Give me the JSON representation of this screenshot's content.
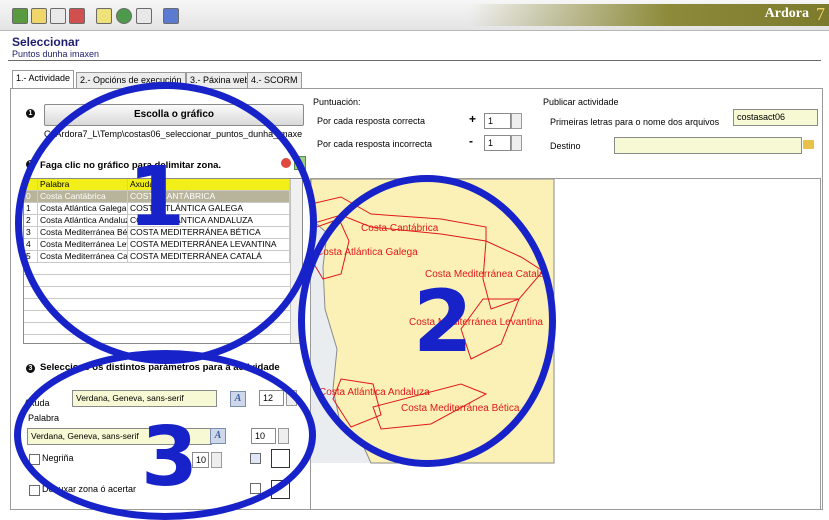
{
  "app": {
    "brand": "Ardora",
    "brand_version": "7",
    "title": "Seleccionar",
    "subtitle": "Puntos dunha imaxen"
  },
  "toolbar": {
    "buttons": [
      "new-doc-icon",
      "open-doc-icon",
      "save-doc-icon",
      "export-doc-icon",
      "page-icon",
      "web-globe-icon",
      "preview-icon",
      "help-icon"
    ]
  },
  "tabs": [
    {
      "label": "1.- Actividade",
      "active": true
    },
    {
      "label": "2.- Opcións de execución",
      "active": false
    },
    {
      "label": "3.- Páxina web",
      "active": false
    },
    {
      "label": "4.- SCORM",
      "active": false
    }
  ],
  "left": {
    "step1_bullet": "1",
    "choose_button": "Escolla o gráfico",
    "path": "C:\\Ardora7_L\\Temp\\costas06_seleccionar_puntos_dunha_imaxe\\",
    "step2_bullet": "2",
    "zone_label": "Faga clic no gráfico para delimitar zona.",
    "table": {
      "headers": [
        "",
        "Palabra",
        "Axuda"
      ],
      "rows": [
        [
          "0",
          "Costa Cantábrica",
          "COSTA CANTÁBRICA"
        ],
        [
          "1",
          "Costa Atlántica Galega",
          "COSTA ATLÁNTICA GALEGA"
        ],
        [
          "2",
          "Costa Atlántica Andaluza",
          "COSTA ATLÁNTICA ANDALUZA"
        ],
        [
          "3",
          "Costa Mediterránea Bética",
          "COSTA MEDITERRÁNEA BÉTICA"
        ],
        [
          "4",
          "Costa Mediterránea Levantina",
          "COSTA MEDITERRÁNEA LEVANTINA"
        ],
        [
          "5",
          "Costa Mediterránea Catalá",
          "COSTA MEDITERRÁNEA CATALÁ"
        ]
      ]
    },
    "step3_bullet": "3",
    "params_label": "Seleccione os distintos parámetros para a actividade",
    "axuda_label": "Axuda",
    "axuda_font": "Verdana, Geneva, sans-serif",
    "axuda_size": "12",
    "palabra_label": "Palabra",
    "palabra_font": "Verdana, Geneva, sans-serif",
    "palabra_size": "10",
    "bold_label": "Negriña",
    "bold_size": "10",
    "mark_zone_label": "Debuxar zona ó acertar",
    "font_button": "A"
  },
  "right": {
    "score_title": "Puntuación:",
    "correct_label": "Por cada resposta correcta",
    "correct_sign": "+",
    "correct_value": "1",
    "incorrect_label": "Por cada resposta incorrecta",
    "incorrect_sign": "-",
    "incorrect_value": "1",
    "publish_title": "Publicar actividade",
    "prefix_label": "Primeiras letras para o nome dos arquivos",
    "prefix_value": "costasact06",
    "dest_label": "Destino",
    "dest_value": ""
  },
  "map": {
    "labels": [
      "Costa Cantábrica",
      "Costa Atlántica Galega",
      "Costa Mediterránea Catalá",
      "Costa Mediterránea Levantina",
      "Costa Atlántica Andaluza",
      "Costa Mediterránea Bética"
    ],
    "land_color": "#fbf1b6",
    "zone_color": "#e01919"
  },
  "annotations": [
    "1",
    "2",
    "3"
  ],
  "colors": {
    "annotation": "#1722c8",
    "grid_header": "#f2ee18",
    "grid_selected": "#b8b49c",
    "input_fill": "#f6f9d3"
  }
}
